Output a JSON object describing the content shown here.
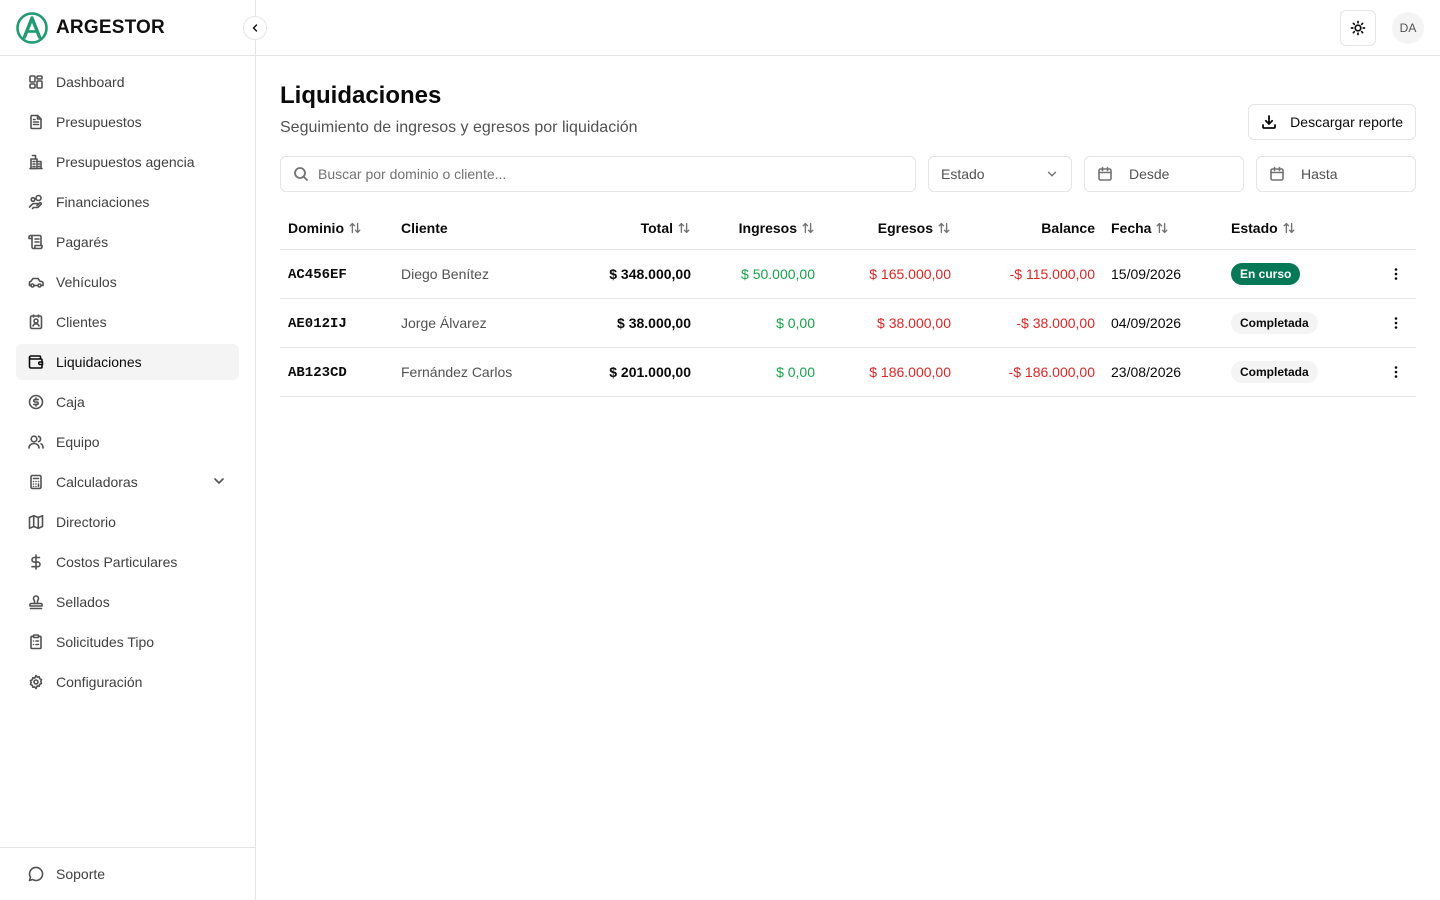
{
  "brand": {
    "name": "ARGESTOR",
    "color": "#1f9b6f"
  },
  "sidebar": {
    "items": [
      {
        "label": "Dashboard",
        "icon": "layout-dashboard-icon"
      },
      {
        "label": "Presupuestos",
        "icon": "file-text-icon"
      },
      {
        "label": "Presupuestos agencia",
        "icon": "building-icon"
      },
      {
        "label": "Financiaciones",
        "icon": "hand-coins-icon"
      },
      {
        "label": "Pagarés",
        "icon": "scroll-icon"
      },
      {
        "label": "Vehículos",
        "icon": "car-icon"
      },
      {
        "label": "Clientes",
        "icon": "contact-icon"
      },
      {
        "label": "Liquidaciones",
        "icon": "wallet-icon",
        "active": true
      },
      {
        "label": "Caja",
        "icon": "circle-dollar-icon"
      },
      {
        "label": "Equipo",
        "icon": "users-icon"
      },
      {
        "label": "Calculadoras",
        "icon": "calculator-icon",
        "expandable": true
      },
      {
        "label": "Directorio",
        "icon": "map-icon"
      },
      {
        "label": "Costos Particulares",
        "icon": "dollar-icon"
      },
      {
        "label": "Sellados",
        "icon": "stamp-icon"
      },
      {
        "label": "Solicitudes Tipo",
        "icon": "clipboard-list-icon"
      },
      {
        "label": "Configuración",
        "icon": "settings-icon"
      }
    ],
    "footer": {
      "label": "Soporte",
      "icon": "message-circle-icon"
    }
  },
  "topbar": {
    "avatar_initials": "DA",
    "theme_icon": "sun-icon"
  },
  "page": {
    "title": "Liquidaciones",
    "subtitle": "Seguimiento de ingresos y egresos por liquidación",
    "download_label": "Descargar reporte"
  },
  "filters": {
    "search_placeholder": "Buscar por dominio o cliente...",
    "status_placeholder": "Estado",
    "from_placeholder": "Desde",
    "to_placeholder": "Hasta"
  },
  "table": {
    "columns": {
      "dominio": "Dominio",
      "cliente": "Cliente",
      "total": "Total",
      "ingresos": "Ingresos",
      "egresos": "Egresos",
      "balance": "Balance",
      "fecha": "Fecha",
      "estado": "Estado"
    },
    "rows": [
      {
        "dominio": "AC456EF",
        "cliente": "Diego Benítez",
        "total": "$ 348.000,00",
        "ingresos": "$ 50.000,00",
        "egresos": "$ 165.000,00",
        "balance": "-$ 115.000,00",
        "fecha": "15/09/2026",
        "estado": "En curso"
      },
      {
        "dominio": "AE012IJ",
        "cliente": "Jorge Álvarez",
        "total": "$ 38.000,00",
        "ingresos": "$ 0,00",
        "egresos": "$ 38.000,00",
        "balance": "-$ 38.000,00",
        "fecha": "04/09/2026",
        "estado": "Completada"
      },
      {
        "dominio": "AB123CD",
        "cliente": "Fernández Carlos",
        "total": "$ 201.000,00",
        "ingresos": "$ 0,00",
        "egresos": "$ 186.000,00",
        "balance": "-$ 186.000,00",
        "fecha": "23/08/2026",
        "estado": "Completada"
      }
    ]
  },
  "colors": {
    "income": "#16a34a",
    "expense": "#dc2626",
    "status_running": "#047857",
    "status_done_bg": "#f4f4f5",
    "active_nav_bg": "#f4f4f5"
  }
}
